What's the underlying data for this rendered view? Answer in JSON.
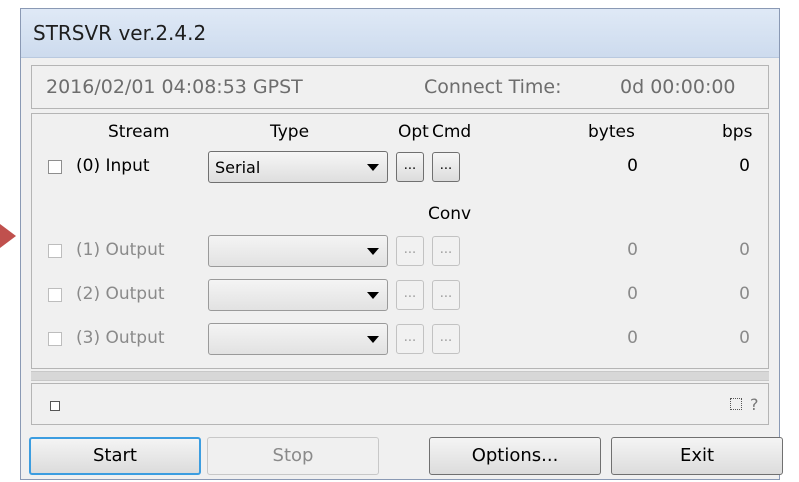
{
  "window": {
    "title": "STRSVR ver.2.4.2"
  },
  "info": {
    "time": "2016/02/01 04:08:53 GPST",
    "connect_label": "Connect Time:",
    "connect_value": "0d 00:00:00"
  },
  "headers": {
    "stream": "Stream",
    "type": "Type",
    "opt": "Opt",
    "cmd": "Cmd",
    "conv": "Conv",
    "bytes": "bytes",
    "bps": "bps"
  },
  "rows": [
    {
      "label": "(0) Input",
      "type": "Serial",
      "opt": "...",
      "cmd": "...",
      "bytes": "0",
      "bps": "0",
      "enabled": true
    },
    {
      "label": "(1) Output",
      "type": "",
      "opt": "...",
      "cmd": "...",
      "bytes": "0",
      "bps": "0",
      "enabled": false
    },
    {
      "label": "(2) Output",
      "type": "",
      "opt": "...",
      "cmd": "...",
      "bytes": "0",
      "bps": "0",
      "enabled": false
    },
    {
      "label": "(3) Output",
      "type": "",
      "opt": "...",
      "cmd": "...",
      "bytes": "0",
      "bps": "0",
      "enabled": false
    }
  ],
  "status": {
    "help": "?"
  },
  "buttons": {
    "start": "Start",
    "stop": "Stop",
    "options": "Options...",
    "exit": "Exit"
  },
  "colors": {
    "accent": "#3c9de0",
    "arrow": "#c0504d"
  }
}
